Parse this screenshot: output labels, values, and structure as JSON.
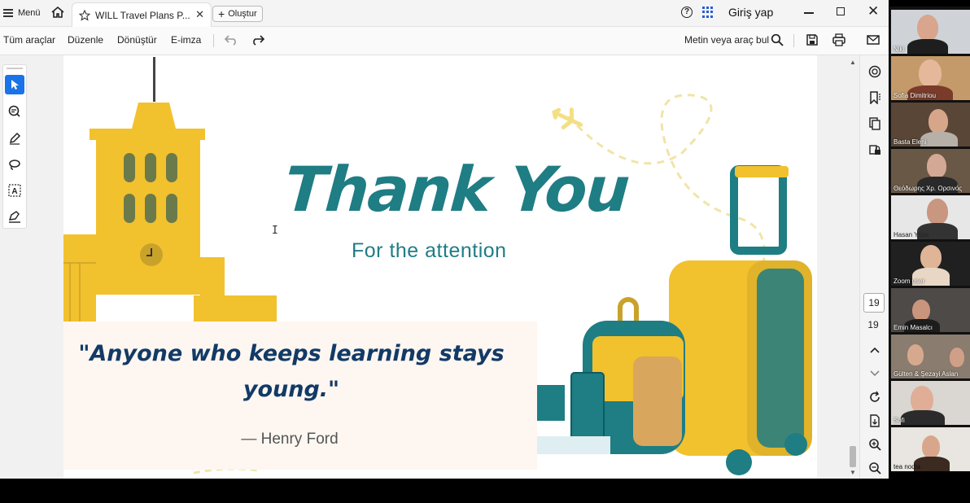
{
  "titlebar": {
    "menu_label": "Menü",
    "tab_title": "WILL Travel Plans P...",
    "new_button_label": "Oluştur",
    "signin_label": "Giriş yap",
    "close_glyph": "✕"
  },
  "toolbar": {
    "items": [
      "Tüm araçlar",
      "Düzenle",
      "Dönüştür",
      "E-imza"
    ],
    "find_label": "Metin veya araç bul"
  },
  "right_rail": {
    "current_page": "19",
    "total_pages": "19"
  },
  "slide": {
    "title": "Thank You",
    "subtitle": "For the attention",
    "quote": "\"Anyone who keeps learning stays young.\"",
    "author": "— Henry Ford"
  },
  "participants": [
    {
      "name": "Niki"
    },
    {
      "name": "Sofia Dimitriou"
    },
    {
      "name": "Basta Eleni"
    },
    {
      "name": "Θεόδωρης Χρ. Ορσινός"
    },
    {
      "name": "Hasan Yüce"
    },
    {
      "name": "Zoom user"
    },
    {
      "name": "Emin Masalcı"
    },
    {
      "name": "Gülten & Şezayi Aslan"
    },
    {
      "name": "Sofi"
    },
    {
      "name": "tea nodia"
    }
  ],
  "colors": {
    "accent_blue": "#1a73e8",
    "slide_teal": "#1f7d84",
    "slide_yellow": "#f2c12e",
    "quote_navy": "#123a66"
  },
  "icons": [
    "menu-icon",
    "home-icon",
    "star-icon",
    "plus-icon",
    "help-icon",
    "apps-icon",
    "undo-icon",
    "redo-icon",
    "search-icon",
    "save-icon",
    "print-icon",
    "mail-icon",
    "select-icon",
    "comment-icon",
    "pen-icon",
    "lasso-icon",
    "text-select-icon",
    "sign-icon",
    "ai-icon",
    "bookmark-icon",
    "pages-icon",
    "protect-icon",
    "rotate-icon",
    "export-icon",
    "zoom-in-icon",
    "zoom-out-icon"
  ]
}
